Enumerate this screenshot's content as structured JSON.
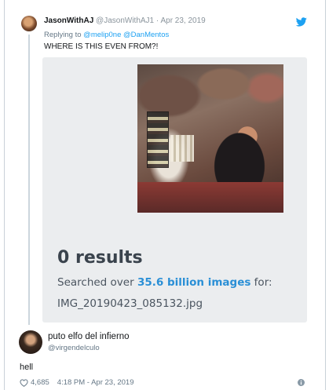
{
  "reply": {
    "display_name": "JasonWithAJ",
    "handle": "@JasonWithAJ1",
    "separator": " · ",
    "date": "Apr 23, 2019",
    "replying_prefix": "Replying to ",
    "replying_handles": "@melip0ne @DanMentos",
    "text": "WHERE IS THIS EVEN FROM?!"
  },
  "media": {
    "results_title": "0 results",
    "searched_prefix": "Searched over ",
    "searched_highlight": "35.6 billion images",
    "searched_suffix": " for:",
    "filename": "IMG_20190423_085132.jpg"
  },
  "main_tweet": {
    "display_name": "puto elfo del infierno",
    "handle": "@virgendelculo",
    "text": "hell",
    "likes": "4,685",
    "timestamp": "4:18 PM - Apr 23, 2019"
  },
  "colors": {
    "twitter_blue": "#1da1f2",
    "highlight_blue": "#2a8fd6",
    "card_background": "#ebedef"
  },
  "icons": [
    "twitter-bird-icon",
    "heart-icon",
    "info-icon"
  ]
}
